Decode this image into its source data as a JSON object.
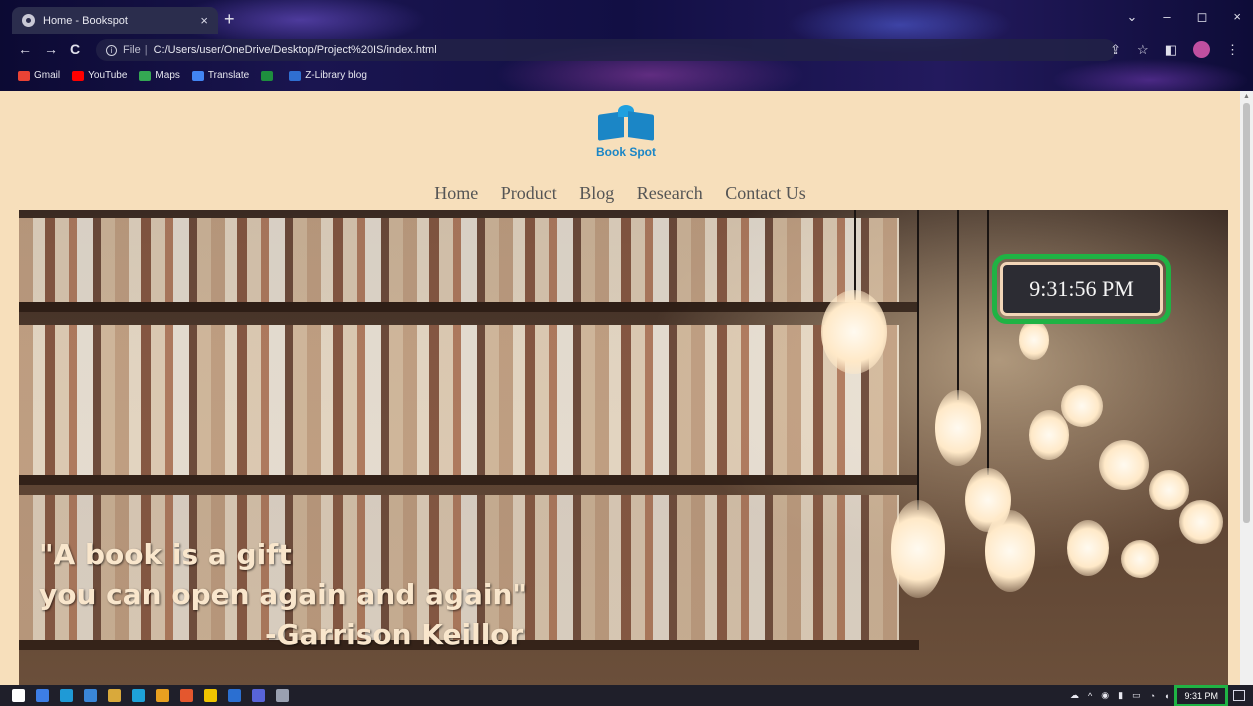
{
  "browser": {
    "tab_title": "Home - Bookspot",
    "tab_close": "×",
    "new_tab": "+",
    "nav": {
      "back": "←",
      "forward": "→",
      "reload": "C"
    },
    "address": {
      "scheme_label": "File",
      "separator": "|",
      "url": "C:/Users/user/OneDrive/Desktop/Project%20IS/index.html"
    },
    "window_controls": {
      "menu": "⌄",
      "minimize": "–",
      "maximize": "◻",
      "close": "×"
    },
    "bookmarks": [
      {
        "label": "Gmail",
        "color": "#ea4335"
      },
      {
        "label": "YouTube",
        "color": "#ff0000"
      },
      {
        "label": "Maps",
        "color": "#34a853"
      },
      {
        "label": "Translate",
        "color": "#4285f4"
      },
      {
        "label": "",
        "color": "#1e8e3e"
      },
      {
        "label": "Z-Library blog",
        "color": "#2f6fd1"
      }
    ]
  },
  "site": {
    "brand": "Book Spot",
    "nav": [
      "Home",
      "Product",
      "Blog",
      "Research",
      "Contact Us"
    ],
    "clock": "9:31:56 PM",
    "quote": {
      "line1": "\"A book is a gift",
      "line2": "you can open again and again\"",
      "author": "-Garrison Keillor"
    }
  },
  "taskbar": {
    "time": "9:31 PM",
    "highlight_color": "#1fb344",
    "app_icon_colors": [
      "#ffffff",
      "#3d7ee6",
      "#1f9ad6",
      "#3a86d8",
      "#d9a93b",
      "#1ea2d8",
      "#e8a020",
      "#e4572e",
      "#f0c400",
      "#2b6fd1",
      "#5864d8",
      "#9aa0b0"
    ]
  }
}
